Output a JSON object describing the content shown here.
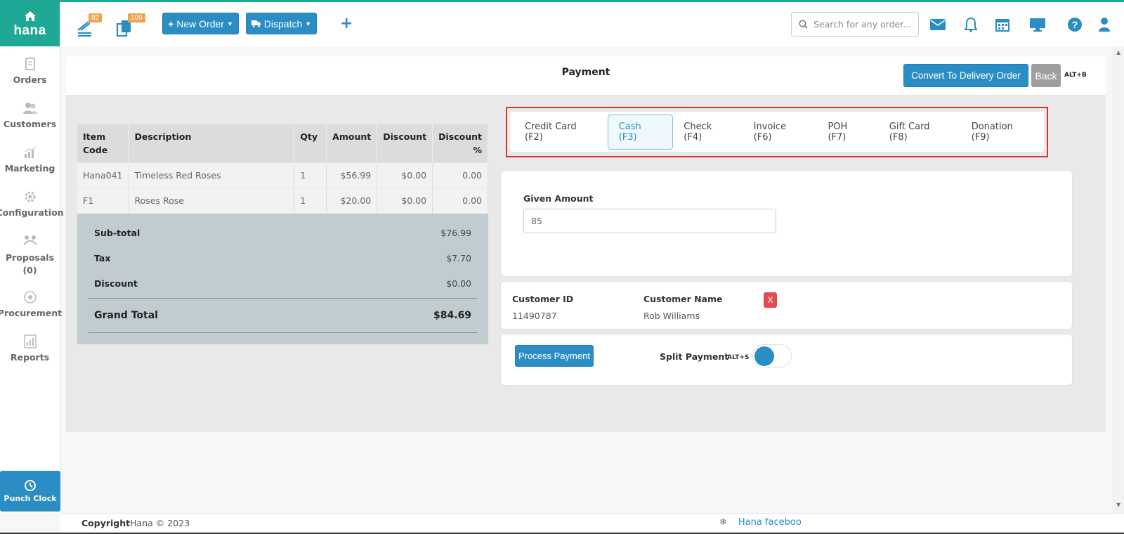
{
  "brand": {
    "name": "hana"
  },
  "sidebar": {
    "items": [
      {
        "label": "Orders"
      },
      {
        "label": "Customers"
      },
      {
        "label": "Marketing"
      },
      {
        "label": "Configuration"
      },
      {
        "label": "Proposals\n(0)"
      },
      {
        "label": "Procurement"
      },
      {
        "label": "Reports"
      }
    ],
    "punch_clock": "Punch Clock"
  },
  "header": {
    "badge_orders": "82",
    "badge_deliveries": "109",
    "new_order": "New Order",
    "dispatch": "Dispatch",
    "search_placeholder": "Search for any order..."
  },
  "page": {
    "title": "Payment",
    "convert_button": "Convert To Delivery Order",
    "back_button": "Back",
    "back_shortcut": "ALT+B"
  },
  "items_table": {
    "headers": [
      "Item Code",
      "Description",
      "Qty",
      "Amount",
      "Discount",
      "Discount %"
    ],
    "rows": [
      {
        "code": "Hana041",
        "description": "Timeless Red Roses",
        "qty": "1",
        "amount": "$56.99",
        "discount": "$0.00",
        "discount_pct": "0.00"
      },
      {
        "code": "F1",
        "description": "Roses Rose",
        "qty": "1",
        "amount": "$20.00",
        "discount": "$0.00",
        "discount_pct": "0.00"
      }
    ]
  },
  "totals": {
    "subtotal_label": "Sub-total",
    "subtotal": "$76.99",
    "tax_label": "Tax",
    "tax": "$7.70",
    "discount_label": "Discount",
    "discount": "$0.00",
    "grand_label": "Grand Total",
    "grand": "$84.69"
  },
  "payment_tabs": [
    {
      "label": "Credit Card (F2)"
    },
    {
      "label": "Cash (F3)",
      "active": true
    },
    {
      "label": "Check (F4)"
    },
    {
      "label": "Invoice (F6)"
    },
    {
      "label": "POH (F7)"
    },
    {
      "label": "Gift Card (F8)"
    },
    {
      "label": "Donation (F9)"
    }
  ],
  "cash": {
    "given_label": "Given Amount",
    "given_value": "85"
  },
  "customer": {
    "id_label": "Customer ID",
    "id": "11490787",
    "name_label": "Customer Name",
    "name": "Rob Williams",
    "remove": "X"
  },
  "actions": {
    "process_payment": "Process Payment",
    "split_payment": "Split Payment",
    "split_shortcut": "ALT+S"
  },
  "footer": {
    "copyright_label": "Copyright",
    "copyright_text": "Hana © 2023",
    "facebook": "Hana faceboo"
  },
  "colors": {
    "brand": "#1fa896",
    "accent": "#2a8ec4",
    "highlight": "#d9352c",
    "danger": "#e14c52"
  }
}
